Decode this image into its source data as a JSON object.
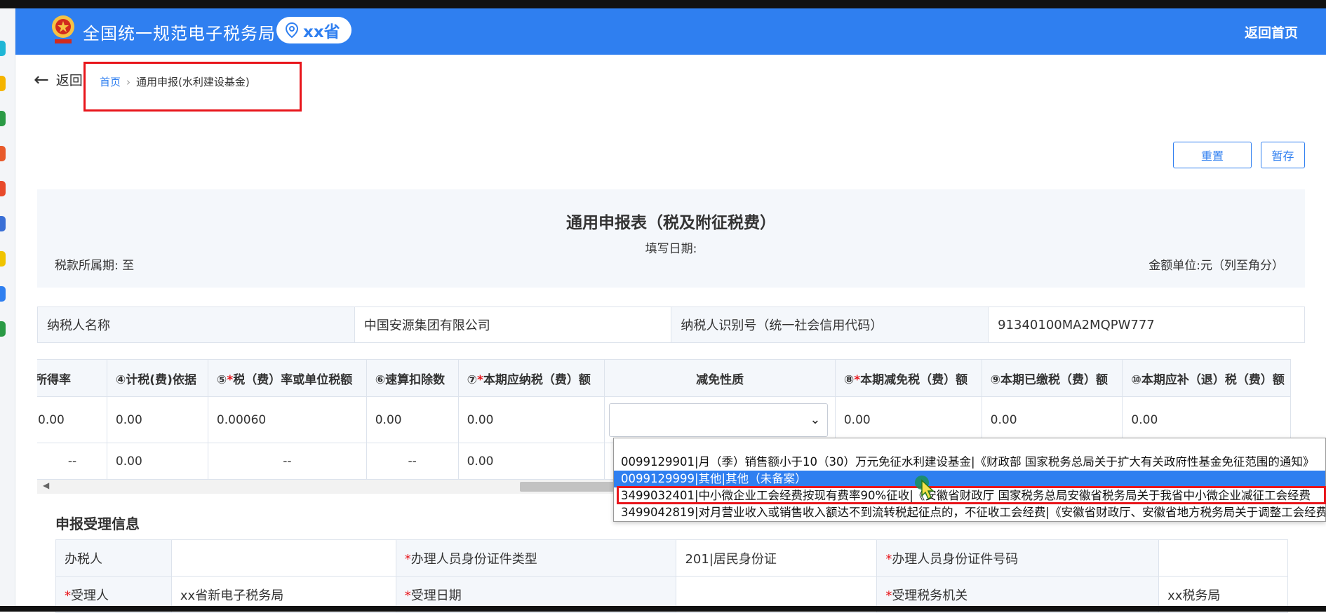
{
  "header": {
    "site_title": "全国统一规范电子税务局",
    "province": "xx省",
    "home_link": "返回首页",
    "brand_color": "#2f7ff0"
  },
  "breadcrumb": {
    "back": "返回",
    "home": "首页",
    "separator": "›",
    "current": "通用申报(水利建设基金)"
  },
  "toolbar": {
    "reset": "重置",
    "save_draft": "暂存"
  },
  "form": {
    "title": "通用申报表（税及附征税费）",
    "fill_date_label": "填写日期:",
    "period_label": "税款所属期: 至",
    "unit_label": "金额单位:元（列至角分）"
  },
  "taxpayer": {
    "name_label": "纳税人名称",
    "name_value": "中国安源集团有限公司",
    "id_label": "纳税人识别号（统一社会信用代码）",
    "id_value": "91340100MA2MQPW777"
  },
  "grid": {
    "headers": [
      {
        "text": "应税所得率",
        "required": false
      },
      {
        "text": "④计税(费)依据",
        "required": false
      },
      {
        "prefix": "⑤",
        "text": "税（费）率或单位税额",
        "required": true
      },
      {
        "text": "⑥速算扣除数",
        "required": false
      },
      {
        "prefix": "⑦",
        "text": "本期应纳税（费）额",
        "required": true
      },
      {
        "text": "减免性质",
        "required": false
      },
      {
        "prefix": "⑧",
        "text": "本期减免税（费）额",
        "required": true
      },
      {
        "text": "⑨本期已缴税（费）额",
        "required": false
      },
      {
        "text": "⑩本期应补（退）税（费）额",
        "required": false
      }
    ],
    "row1": [
      "0.00",
      "0.00",
      "0.00060",
      "0.00",
      "0.00",
      "",
      "0.00",
      "0.00",
      "0.00"
    ],
    "row2": [
      "--",
      "0.00",
      "--",
      "--",
      "0.00"
    ]
  },
  "dropdown": {
    "options": [
      "0099129901|月（季）销售额小于10（30）万元免征水利建设基金|《财政部 国家税务总局关于扩大有关政府性基金免征范围的通知》",
      "0099129999|其他|其他（未备案）",
      "3499032401|中小微企业工会经费按现有费率90%征收|《安徽省财政厅 国家税务总局安徽省税务局关于我省中小微企业减征工会经费",
      "3499042819|对月营业收入或销售收入额达不到流转税起征点的，不征收工会经费|《安徽省财政厅、安徽省地方税务局关于调整工会经费"
    ],
    "selected_index": 1,
    "highlighted_index": 2
  },
  "receipt": {
    "section_title": "申报受理信息",
    "row1": {
      "handler_label": "办税人",
      "handler_value": "",
      "id_type_label": "办理人员身份证件类型",
      "id_type_value": "201|居民身份证",
      "id_no_label": "办理人员身份证件号码",
      "id_no_value": ""
    },
    "row2": {
      "receiver_label": "受理人",
      "receiver_value": "xx省新电子税务局",
      "date_label": "受理日期",
      "date_value": "",
      "office_label": "受理税务机关",
      "office_value": "xx税务局"
    }
  },
  "colors": {
    "annotation_red": "#e8151b",
    "required_star": "#e8151b"
  }
}
